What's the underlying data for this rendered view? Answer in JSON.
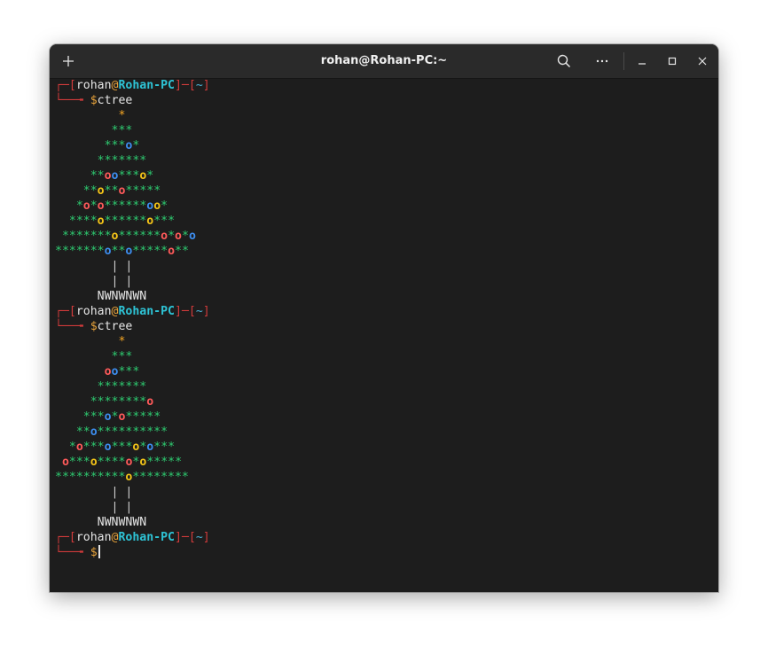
{
  "window": {
    "title": "rohan@Rohan-PC:~",
    "buttons": [
      "new-tab",
      "search",
      "menu",
      "minimize",
      "maximize",
      "close"
    ]
  },
  "prompt": {
    "open": "┌─[",
    "user": "rohan",
    "at": "@",
    "host": "Rohan-PC",
    "mid": "]─[",
    "cwd": "~",
    "close": "]",
    "second": "└──╼ ",
    "dollar": "$"
  },
  "commands": [
    "ctree",
    "ctree"
  ],
  "trees": [
    {
      "rows": [
        [
          [
            "s",
            "         *"
          ]
        ],
        [
          [
            "g",
            "        ***"
          ]
        ],
        [
          [
            "g",
            "       ***"
          ],
          [
            "b",
            "o"
          ],
          [
            "g",
            "*"
          ]
        ],
        [
          [
            "g",
            "      *******"
          ]
        ],
        [
          [
            "g",
            "     **"
          ],
          [
            "r",
            "o"
          ],
          [
            "b",
            "o"
          ],
          [
            "g",
            "***"
          ],
          [
            "y",
            "o"
          ],
          [
            "g",
            "*"
          ]
        ],
        [
          [
            "g",
            "    **"
          ],
          [
            "y",
            "o"
          ],
          [
            "g",
            "**"
          ],
          [
            "r",
            "o"
          ],
          [
            "g",
            "*****"
          ]
        ],
        [
          [
            "g",
            "   *"
          ],
          [
            "r",
            "o"
          ],
          [
            "g",
            "*"
          ],
          [
            "r",
            "o"
          ],
          [
            "g",
            "******"
          ],
          [
            "b",
            "o"
          ],
          [
            "y",
            "o"
          ],
          [
            "g",
            "*"
          ]
        ],
        [
          [
            "g",
            "  ****"
          ],
          [
            "y",
            "o"
          ],
          [
            "g",
            "******"
          ],
          [
            "y",
            "o"
          ],
          [
            "g",
            "***"
          ]
        ],
        [
          [
            "g",
            " *******"
          ],
          [
            "y",
            "o"
          ],
          [
            "g",
            "******"
          ],
          [
            "r",
            "o"
          ],
          [
            "g",
            "*"
          ],
          [
            "r",
            "o"
          ],
          [
            "g",
            "*"
          ],
          [
            "b",
            "o"
          ]
        ],
        [
          [
            "g",
            "*******"
          ],
          [
            "b",
            "o"
          ],
          [
            "g",
            "**"
          ],
          [
            "b",
            "o"
          ],
          [
            "g",
            "*****"
          ],
          [
            "r",
            "o"
          ],
          [
            "g",
            "**"
          ]
        ]
      ],
      "trunk": [
        "        | |",
        "        | |"
      ],
      "base": "      NWNWNWN"
    },
    {
      "rows": [
        [
          [
            "s",
            "         *"
          ]
        ],
        [
          [
            "g",
            "        ***"
          ]
        ],
        [
          [
            "g",
            "       "
          ],
          [
            "r",
            "o"
          ],
          [
            "b",
            "o"
          ],
          [
            "g",
            "***"
          ]
        ],
        [
          [
            "g",
            "      *******"
          ]
        ],
        [
          [
            "g",
            "     ********"
          ],
          [
            "r",
            "o"
          ]
        ],
        [
          [
            "g",
            "    ***"
          ],
          [
            "b",
            "o"
          ],
          [
            "g",
            "*"
          ],
          [
            "r",
            "o"
          ],
          [
            "g",
            "*****"
          ]
        ],
        [
          [
            "g",
            "   **"
          ],
          [
            "b",
            "o"
          ],
          [
            "g",
            "**********"
          ]
        ],
        [
          [
            "g",
            "  *"
          ],
          [
            "r",
            "o"
          ],
          [
            "g",
            "***"
          ],
          [
            "b",
            "o"
          ],
          [
            "g",
            "***"
          ],
          [
            "y",
            "o"
          ],
          [
            "g",
            "*"
          ],
          [
            "b",
            "o"
          ],
          [
            "g",
            "***"
          ]
        ],
        [
          [
            "g",
            " "
          ],
          [
            "r",
            "o"
          ],
          [
            "g",
            "***"
          ],
          [
            "y",
            "o"
          ],
          [
            "g",
            "****"
          ],
          [
            "r",
            "o"
          ],
          [
            "g",
            "*"
          ],
          [
            "y",
            "o"
          ],
          [
            "g",
            "*****"
          ]
        ],
        [
          [
            "g",
            "**********"
          ],
          [
            "y",
            "o"
          ],
          [
            "g",
            "********"
          ]
        ]
      ],
      "trunk": [
        "        | |",
        "        | |"
      ],
      "base": "      NWNWNWN"
    }
  ]
}
